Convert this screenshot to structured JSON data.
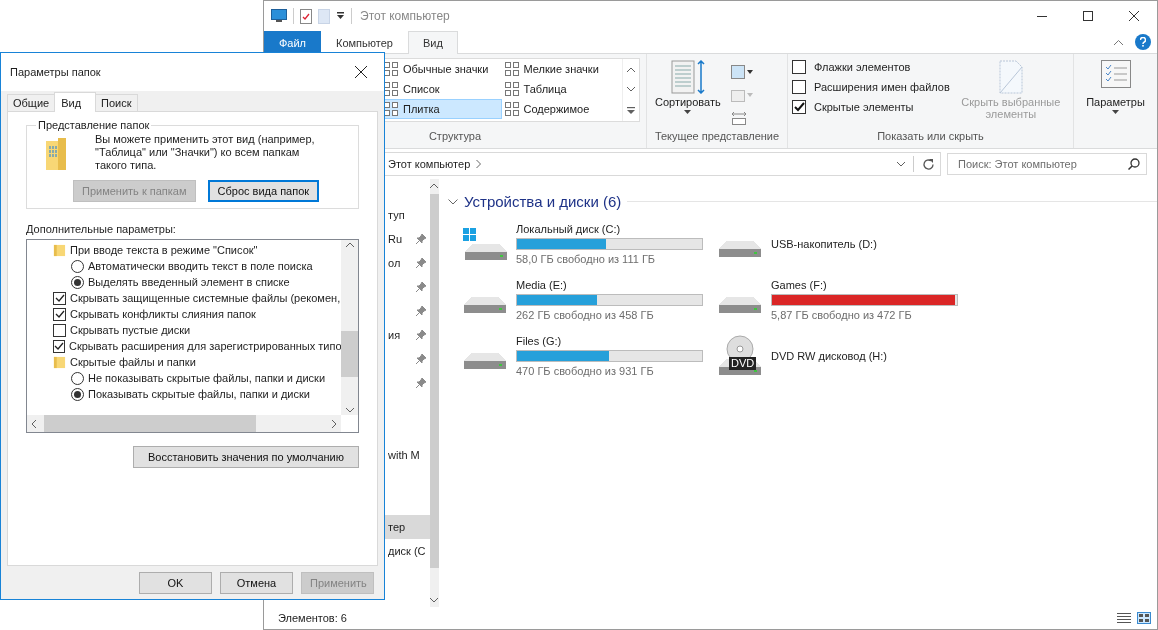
{
  "explorer": {
    "title": "Этот компьютер",
    "ribbon_tabs": [
      {
        "label": "Файл",
        "kind": "file",
        "selected": false
      },
      {
        "label": "Компьютер",
        "kind": "tab",
        "selected": false
      },
      {
        "label": "Вид",
        "kind": "tab",
        "selected": true
      }
    ],
    "layout_gallery": {
      "items": [
        {
          "label": "Обычные значки",
          "selected": false
        },
        {
          "label": "Мелкие значки",
          "selected": false
        },
        {
          "label": "Список",
          "selected": false
        },
        {
          "label": "Таблица",
          "selected": false
        },
        {
          "label": "Плитка",
          "selected": true
        },
        {
          "label": "Содержимое",
          "selected": false
        }
      ],
      "group_label": "Структура"
    },
    "current_view": {
      "sort_label": "Сортировать",
      "group_label": "Текущее представление"
    },
    "show_hide": {
      "options": [
        {
          "label": "Флажки элементов",
          "checked": false
        },
        {
          "label": "Расширения имен файлов",
          "checked": false
        },
        {
          "label": "Скрытые элементы",
          "checked": true
        }
      ],
      "hide_selected": {
        "label": "Скрыть выбранные элементы",
        "disabled": true
      },
      "group_label": "Показать или скрыть"
    },
    "options_label": "Параметры",
    "address": {
      "path": "Этот компьютер"
    },
    "search": {
      "placeholder": "Поиск: Этот компьютер"
    },
    "nav_sections": [
      {
        "items": [
          {
            "label": "туп",
            "pinned": false,
            "selected": false
          },
          {
            "label": "Ru",
            "pinned": true,
            "selected": false
          },
          {
            "label": "ол",
            "pinned": true,
            "selected": false
          },
          {
            "pinned": true,
            "selected": false
          },
          {
            "pinned": true,
            "selected": false
          },
          {
            "label": "ия",
            "pinned": true,
            "selected": false
          },
          {
            "pinned": true,
            "selected": false
          },
          {
            "pinned": true,
            "selected": false
          }
        ]
      },
      {
        "items": [
          {
            "label": "with M",
            "pinned": false,
            "selected": false
          }
        ]
      },
      {
        "items": [
          {
            "label": "тер",
            "pinned": false,
            "selected": true
          },
          {
            "label": "диск (C",
            "pinned": false,
            "selected": false
          }
        ]
      }
    ],
    "group_title": "Устройства и диски (6)",
    "drives": [
      {
        "name": "Локальный диск (C:)",
        "kind": "system",
        "level": 0.48,
        "color": "#26a0da",
        "free": "58,0 ГБ свободно из 111 ГБ"
      },
      {
        "name": "USB-накопитель (D:)",
        "kind": "drive"
      },
      {
        "name": "Media (E:)",
        "kind": "drive",
        "level": 0.43,
        "color": "#26a0da",
        "free": "262 ГБ свободно из 458 ГБ"
      },
      {
        "name": "Games (F:)",
        "kind": "drive",
        "level": 0.99,
        "color": "#da2626",
        "free": "5,87 ГБ свободно из 472 ГБ"
      },
      {
        "name": "Files (G:)",
        "kind": "drive",
        "level": 0.495,
        "color": "#26a0da",
        "free": "470 ГБ свободно из 931 ГБ"
      },
      {
        "name": "DVD RW дисковод (H:)",
        "kind": "dvd",
        "icon_label": "DVD"
      }
    ],
    "status": "Элементов: 6"
  },
  "dialog": {
    "title": "Параметры папок",
    "tabs": [
      {
        "label": "Общие",
        "selected": false
      },
      {
        "label": "Вид",
        "selected": true
      },
      {
        "label": "Поиск",
        "selected": false
      }
    ],
    "folder_views": {
      "legend": "Представление папок",
      "text": "Вы можете применить этот вид (например, \"Таблица\" или \"Значки\") ко всем папкам такого типа.",
      "buttons": [
        {
          "label": "Применить к папкам",
          "disabled": true,
          "default": false
        },
        {
          "label": "Сброс вида папок",
          "disabled": false,
          "default": true
        }
      ]
    },
    "advanced_label": "Дополнительные параметры:",
    "advanced": [
      {
        "kind": "folder",
        "label": "При вводе текста в режиме \"Список\"",
        "children": [
          {
            "kind": "radio",
            "label": "Автоматически вводить текст в поле поиска",
            "selected": false
          },
          {
            "kind": "radio",
            "label": "Выделять введенный элемент в списке",
            "selected": true
          }
        ]
      },
      {
        "kind": "checkbox",
        "label": "Скрывать защищенные системные файлы (рекомен,",
        "checked": true
      },
      {
        "kind": "checkbox",
        "label": "Скрывать конфликты слияния папок",
        "checked": true
      },
      {
        "kind": "checkbox",
        "label": "Скрывать пустые диски",
        "checked": false
      },
      {
        "kind": "checkbox",
        "label": "Скрывать расширения для зарегистрированных типо",
        "checked": true
      },
      {
        "kind": "folder",
        "label": "Скрытые файлы и папки",
        "children": [
          {
            "kind": "radio",
            "label": "Не показывать скрытые файлы, папки и диски",
            "selected": false
          },
          {
            "kind": "radio",
            "label": "Показывать скрытые файлы, папки и диски",
            "selected": true
          }
        ]
      }
    ],
    "restore_button": "Восстановить значения по умолчанию",
    "buttons": [
      {
        "label": "OK",
        "disabled": false
      },
      {
        "label": "Отмена",
        "disabled": false
      },
      {
        "label": "Применить",
        "disabled": true
      }
    ]
  }
}
